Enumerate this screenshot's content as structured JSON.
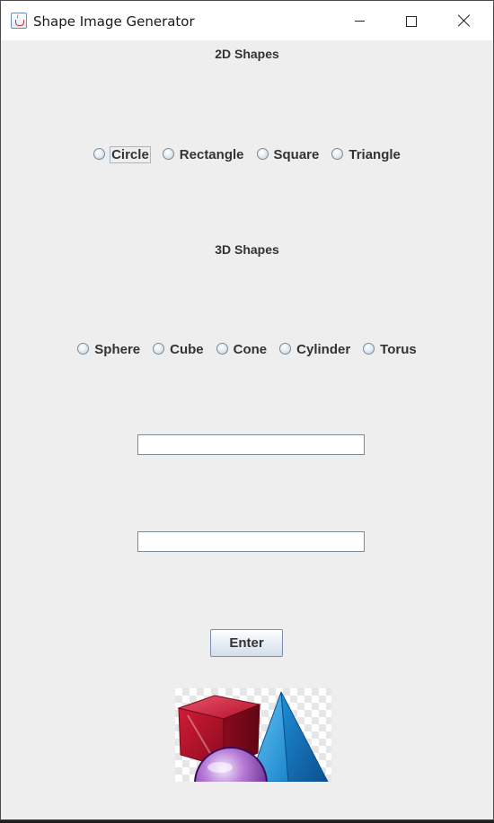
{
  "window": {
    "title": "Shape Image Generator",
    "icon": "java-cup-icon"
  },
  "title_controls": {
    "minimize": "minimize-icon",
    "maximize": "maximize-icon",
    "close": "close-icon"
  },
  "shapes_2d": {
    "label": "2D Shapes",
    "options": [
      "Circle",
      "Rectangle",
      "Square",
      "Triangle"
    ]
  },
  "shapes_3d": {
    "label": "3D Shapes",
    "options": [
      "Sphere",
      "Cube",
      "Cone",
      "Cylinder",
      "Torus"
    ]
  },
  "inputs": {
    "first_value": "",
    "second_value": ""
  },
  "enter_button": {
    "label": "Enter"
  },
  "image": {
    "content": "3d-shapes-image"
  },
  "colors": {
    "window_bg": "#eeeeee",
    "titlebar_bg": "#ffffff",
    "text": "#333333",
    "cube": "#c8102e",
    "pyramid": "#1e90d6",
    "sphere": "#7a1fa2"
  }
}
